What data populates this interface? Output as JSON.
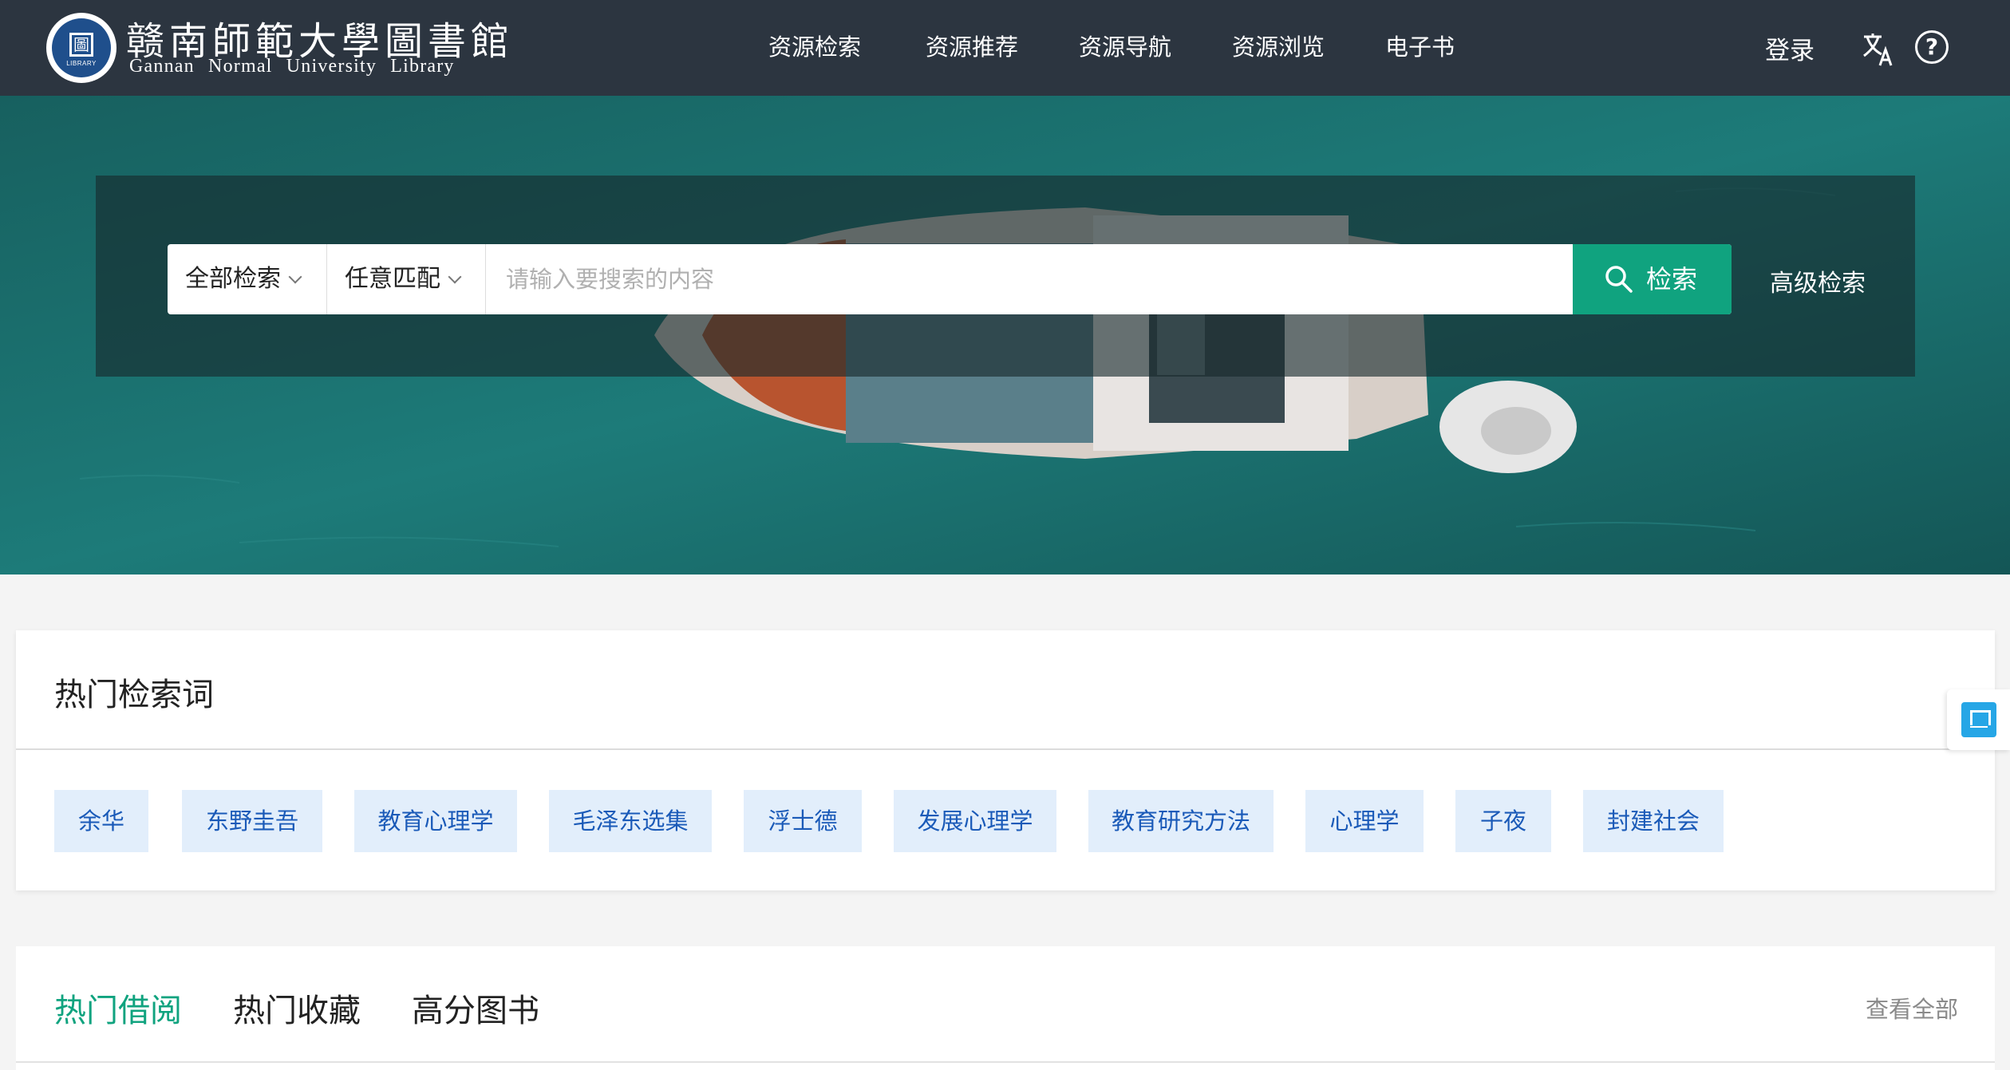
{
  "header": {
    "logo_glyph": "圖",
    "logo_ring_text": "LIBRARY",
    "logo_cn": "赣南師範大學圖書館",
    "logo_en": "Gannan Normal University Library",
    "nav": [
      {
        "label": "资源检索"
      },
      {
        "label": "资源推荐"
      },
      {
        "label": "资源导航"
      },
      {
        "label": "资源浏览"
      },
      {
        "label": "电子书"
      }
    ],
    "login_label": "登录",
    "help_glyph": "?"
  },
  "search": {
    "scope_label": "全部检索",
    "match_label": "任意匹配",
    "placeholder": "请输入要搜索的内容",
    "value": "",
    "button_label": "检索",
    "advanced_label": "高级检索"
  },
  "hot_search": {
    "title": "热门检索词",
    "tags": [
      "余华",
      "东野圭吾",
      "教育心理学",
      "毛泽东选集",
      "浮士德",
      "发展心理学",
      "教育研究方法",
      "心理学",
      "子夜",
      "封建社会"
    ]
  },
  "hot_books": {
    "tabs": [
      {
        "label": "热门借阅",
        "active": true
      },
      {
        "label": "热门收藏",
        "active": false
      },
      {
        "label": "高分图书",
        "active": false
      }
    ],
    "view_all_label": "查看全部"
  },
  "colors": {
    "header_bg": "#2c3540",
    "accent": "#10a37f",
    "sea": "#1b7272",
    "tag_bg": "#e2eefb",
    "tag_text": "#1a5ab8"
  }
}
